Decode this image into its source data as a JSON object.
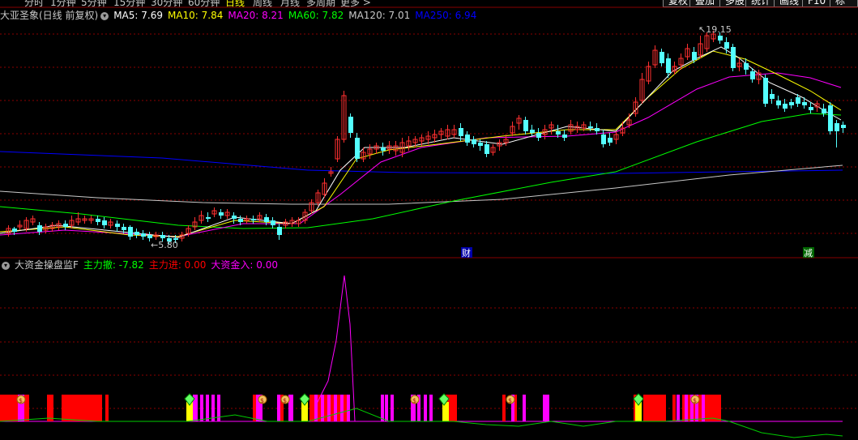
{
  "toolbar": {
    "timeframes": [
      "分时",
      "1分钟",
      "5分钟",
      "15分钟",
      "30分钟",
      "60分钟",
      "日线",
      "周线",
      "月线",
      "多周期",
      "更多"
    ],
    "active": "日线",
    "right_buttons": [
      "复权",
      "叠加",
      "多股",
      "统计",
      "画线",
      "F10",
      "标记"
    ]
  },
  "main_chart": {
    "stock_label": "大亚圣象(日线 前复权)",
    "ma": [
      {
        "label": "MA5: 7.69",
        "color": "#ffffff"
      },
      {
        "label": "MA10: 7.84",
        "color": "#ffff00"
      },
      {
        "label": "MA20: 8.21",
        "color": "#ff00ff"
      },
      {
        "label": "MA60: 7.82",
        "color": "#00ff00"
      },
      {
        "label": "MA120: 7.01",
        "color": "#c8c8c8"
      },
      {
        "label": "MA250: 6.94",
        "color": "#0000ff"
      }
    ],
    "high_marker": "19.15",
    "low_marker": "5.80",
    "event_labels": {
      "cai": "财",
      "jian": "减"
    }
  },
  "indicator": {
    "name": "大资金操盘监F",
    "items": [
      {
        "label": "主力撤: -7.82",
        "color": "#00ff00"
      },
      {
        "label": "主力进: 0.00",
        "color": "#ff0000"
      },
      {
        "label": "大资金入: 0.00",
        "color": "#ff00ff"
      }
    ]
  },
  "colors": {
    "up": "#ff3030",
    "down": "#54ffff",
    "grid": "#8b0000",
    "sep": "#880000",
    "ma5": "#ffffff",
    "ma10": "#ffff00",
    "ma20": "#ff00ff",
    "ma60": "#00ff00",
    "ma120": "#c8c8c8",
    "ma250": "#0000ff"
  }
}
